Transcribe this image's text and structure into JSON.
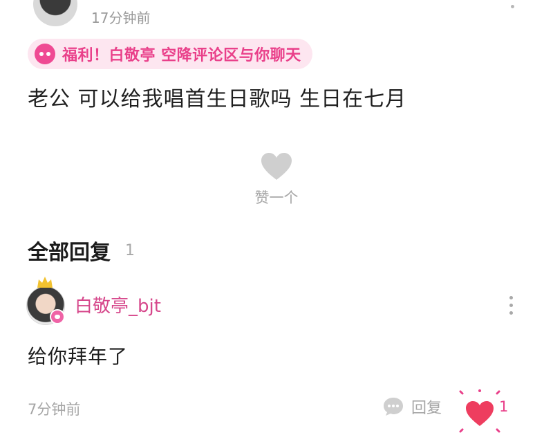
{
  "post": {
    "time": "17分钟前",
    "banner_text": "福利！白敬亭 空降评论区与你聊天",
    "content": "老公 可以给我唱首生日歌吗 生日在七月",
    "like_label": "赞一个"
  },
  "replies": {
    "title": "全部回复",
    "count": "1"
  },
  "reply": {
    "username": "白敬亭_bjt",
    "content": "给你拜年了",
    "time": "7分钟前",
    "reply_label": "回复",
    "like_count": "1"
  },
  "colors": {
    "accent_pink": "#e9408a",
    "banner_bg": "#fde6f0",
    "muted_gray": "#a6a6a6"
  },
  "icons": [
    "avatar",
    "more-dots-icon",
    "chat-bubble-icon",
    "heart-outline-icon",
    "speech-bubble-icon",
    "heart-filled-icon",
    "crown-icon"
  ]
}
